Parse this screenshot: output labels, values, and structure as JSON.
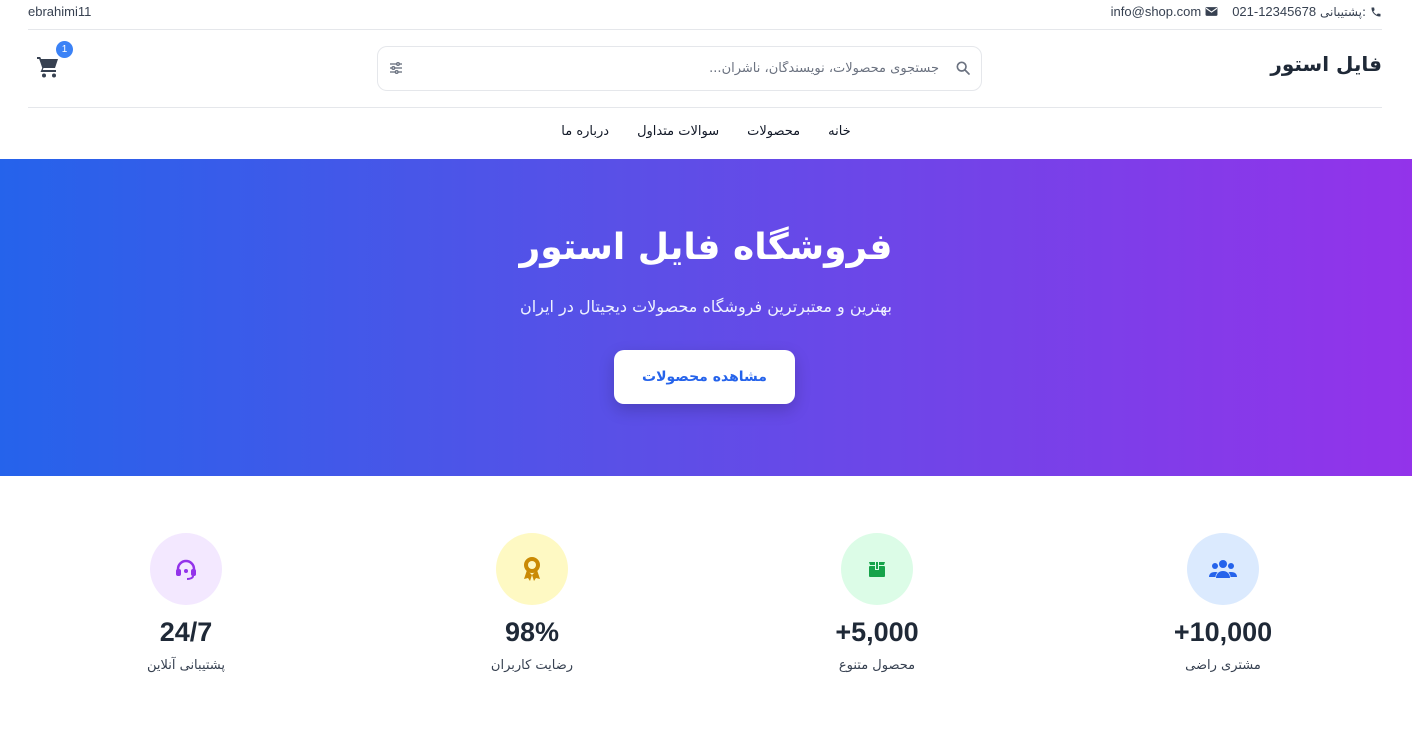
{
  "topbar": {
    "username": "ebrahimi11",
    "support_label": "پشتیبانی:",
    "support_phone": "021-12345678",
    "email": "info@shop.com"
  },
  "header": {
    "logo": "فایل استور",
    "search_placeholder": "جستجوی محصولات، نویسندگان، ناشران...",
    "cart_count": "1"
  },
  "nav": {
    "items": [
      "خانه",
      "محصولات",
      "سوالات متداول",
      "درباره ما"
    ]
  },
  "hero": {
    "title": "فروشگاه فایل استور",
    "subtitle": "بهترین و معتبرترین فروشگاه محصولات دیجیتال در ایران",
    "cta_label": "مشاهده محصولات"
  },
  "stats": [
    {
      "value": "+10,000",
      "label": "مشتری راضی",
      "icon": "users-icon",
      "bg": "#dbeafe",
      "color": "#2563eb"
    },
    {
      "value": "+5,000",
      "label": "محصول متنوع",
      "icon": "box-icon",
      "bg": "#dcfce7",
      "color": "#16a34a"
    },
    {
      "value": "98%",
      "label": "رضایت کاربران",
      "icon": "award-icon",
      "bg": "#fef9c3",
      "color": "#ca8a04"
    },
    {
      "value": "24/7",
      "label": "پشتیبانی آنلاین",
      "icon": "headset-icon",
      "bg": "#f3e8ff",
      "color": "#9333ea"
    }
  ],
  "colors": {
    "accent": "#2563eb",
    "hero_gradient_start": "#2563eb",
    "hero_gradient_end": "#9333ea"
  }
}
